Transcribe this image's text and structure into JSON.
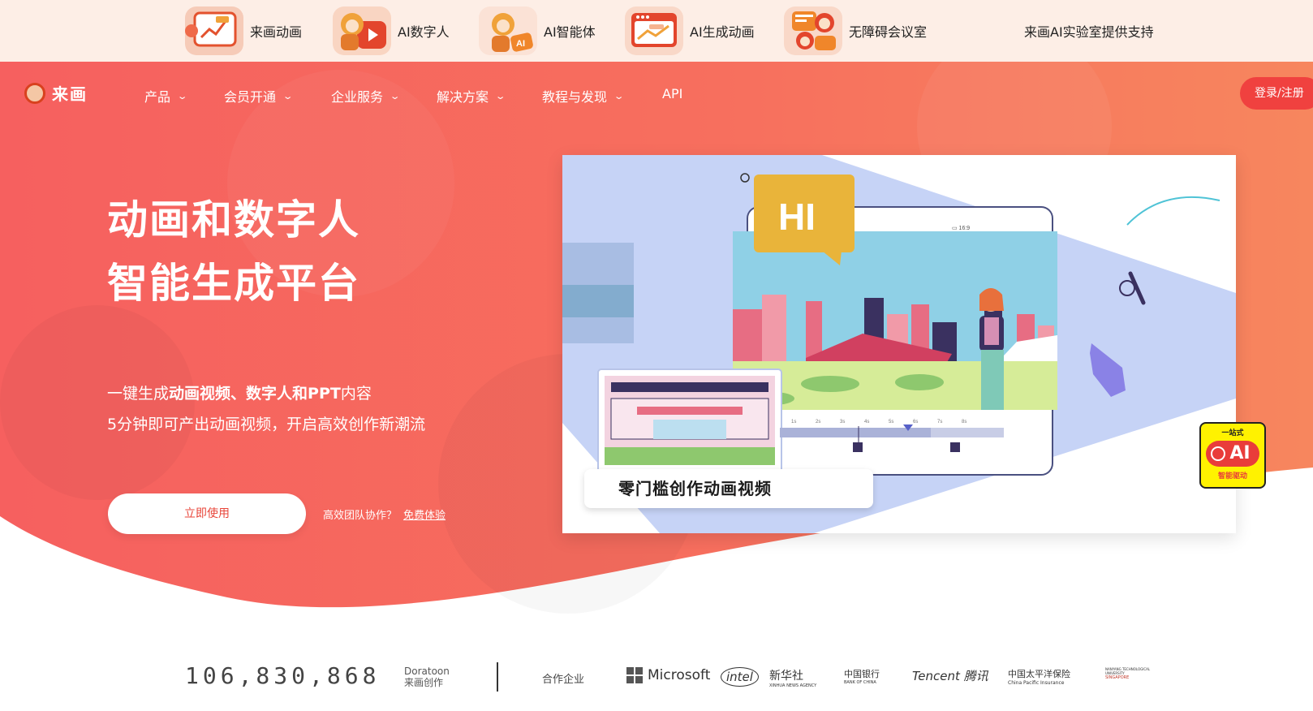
{
  "top_products": [
    {
      "label": "来画动画",
      "icon": "presentation-chart-icon"
    },
    {
      "label": "AI数字人",
      "icon": "digital-human-play-icon"
    },
    {
      "label": "AI智能体",
      "icon": "ai-agent-icon"
    },
    {
      "label": "AI生成动画",
      "icon": "animation-window-icon"
    },
    {
      "label": "无障碍会议室",
      "icon": "meeting-room-icon"
    }
  ],
  "top_lab_text": "来画AI实验室提供支持",
  "nav": {
    "logo_text": "来画",
    "items": [
      {
        "label": "产品",
        "has_dropdown": true
      },
      {
        "label": "会员开通",
        "has_dropdown": true
      },
      {
        "label": "企业服务",
        "has_dropdown": true
      },
      {
        "label": "解决方案",
        "has_dropdown": true
      },
      {
        "label": "教程与发现",
        "has_dropdown": true
      },
      {
        "label": "API",
        "has_dropdown": false
      }
    ],
    "chevron": "⌄",
    "login_label": "登录/注册"
  },
  "hero": {
    "title_line1": "动画和数字人",
    "title_line2": "智能生成平台",
    "sub_prefix": "一键生成",
    "sub_bold": "动画视频、数字人和PPT",
    "sub_suffix": "内容",
    "sub_line2": "5分钟即可产出动画视频，开启高效创作新潮流",
    "cta_label": "立即使用",
    "team_text": "高效团队协作？",
    "team_link": "免费体验"
  },
  "illustration": {
    "bubble_text": "HI",
    "tagline": "零门槛创作动画视频",
    "timeline_ticks": [
      "1s",
      "2s",
      "3s",
      "4s",
      "5s",
      "6s",
      "7s",
      "8s"
    ],
    "toolbar_text": "16:9"
  },
  "ai_badge": {
    "top": "一站式",
    "main": "AI",
    "bottom": "智能驱动"
  },
  "stats": {
    "count": "106,830,868",
    "brand_en": "Doratoon",
    "brand_cn": "来画创作",
    "partners_label": "合作企业"
  },
  "partners": [
    "Microsoft",
    "intel",
    "新华社",
    "中国银行",
    "Tencent 腾讯",
    "中国太平洋保险",
    "NANYANG TECHNOLOGICAL UNIVERSITY"
  ],
  "partners_sub": {
    "xinhua": "XINHUA NEWS AGENCY",
    "boc": "BANK OF CHINA",
    "cpic": "China Pacific Insurance",
    "ntu": "SINGAPORE"
  },
  "colors": {
    "topbar_bg": "#fdeee6",
    "hero_start": "#f5605f",
    "hero_end": "#f7815e",
    "accent_red": "#f0413f",
    "badge_yellow": "#fff200"
  }
}
